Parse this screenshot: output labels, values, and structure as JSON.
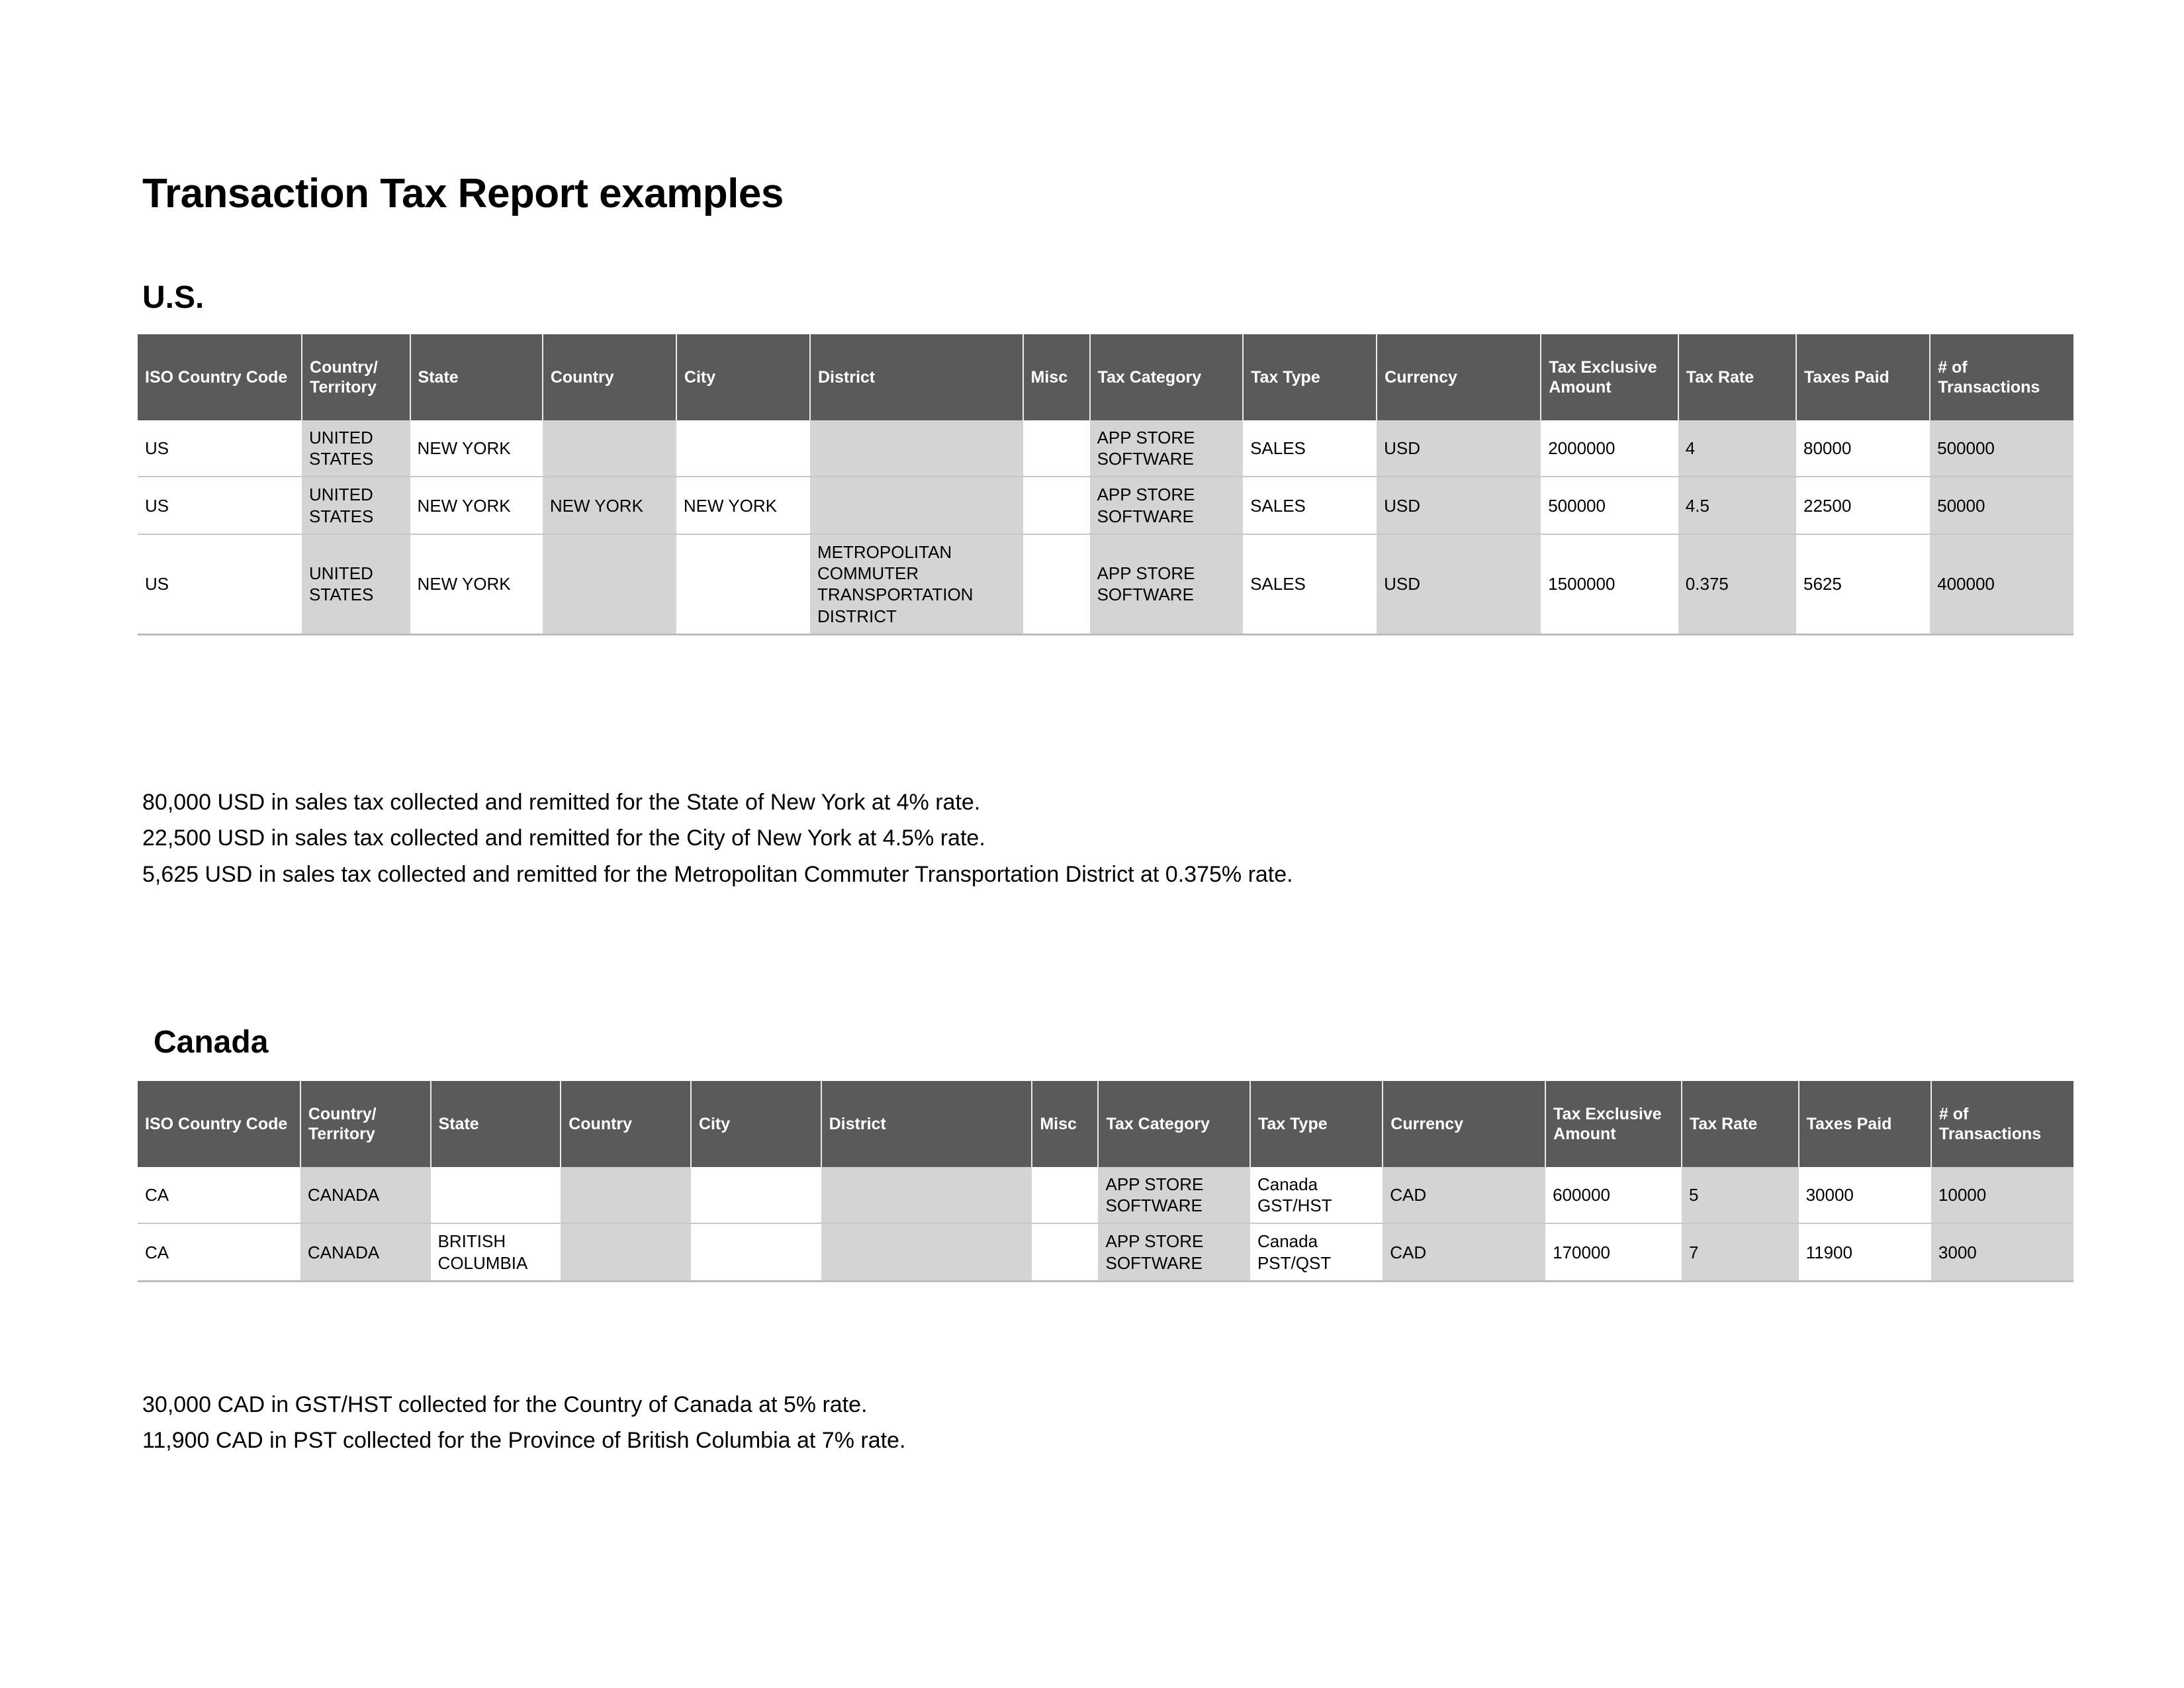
{
  "document": {
    "title": "Transaction Tax Report examples"
  },
  "columns": [
    "ISO Country Code",
    "Country/ Territory",
    "State",
    "Country",
    "City",
    "District",
    "Misc",
    "Tax Category",
    "Tax Type",
    "Currency",
    "Tax Exclusive Amount",
    "Tax Rate",
    "Taxes Paid",
    "# of Transactions"
  ],
  "colors": {
    "header_bg": "#5a5a5a",
    "header_text": "#ffffff",
    "shaded_cell_bg": "#d4d4d4",
    "plain_cell_bg": "#ffffff",
    "row_divider": "#c8c8c8"
  },
  "us": {
    "heading": "U.S.",
    "rows": [
      {
        "iso_country_code": "US",
        "country_territory": "UNITED STATES",
        "state": "NEW YORK",
        "country": "",
        "city": "",
        "district": "",
        "misc": "",
        "tax_category": "APP STORE SOFTWARE",
        "tax_type": "SALES",
        "currency": "USD",
        "tax_exclusive_amount": "2000000",
        "tax_rate": "4",
        "taxes_paid": "80000",
        "num_transactions": "500000"
      },
      {
        "iso_country_code": "US",
        "country_territory": "UNITED STATES",
        "state": "NEW YORK",
        "country": "NEW YORK",
        "city": "NEW YORK",
        "district": "",
        "misc": "",
        "tax_category": "APP STORE SOFTWARE",
        "tax_type": "SALES",
        "currency": "USD",
        "tax_exclusive_amount": "500000",
        "tax_rate": "4.5",
        "taxes_paid": "22500",
        "num_transactions": "50000"
      },
      {
        "iso_country_code": "US",
        "country_territory": "UNITED STATES",
        "state": "NEW YORK",
        "country": "",
        "city": "",
        "district": "METROPOLITAN COMMUTER TRANSPORTATION DISTRICT",
        "misc": "",
        "tax_category": "APP STORE SOFTWARE",
        "tax_type": "SALES",
        "currency": "USD",
        "tax_exclusive_amount": "1500000",
        "tax_rate": "0.375",
        "taxes_paid": "5625",
        "num_transactions": "400000"
      }
    ],
    "notes": [
      "80,000 USD in sales tax collected and remitted for the State of New York at 4% rate.",
      "22,500 USD in sales tax collected and remitted for the City of New York at 4.5% rate.",
      "5,625 USD in sales tax collected and remitted for the Metropolitan Commuter Transportation District at 0.375% rate."
    ]
  },
  "canada": {
    "heading": "Canada",
    "rows": [
      {
        "iso_country_code": "CA",
        "country_territory": "CANADA",
        "state": "",
        "country": "",
        "city": "",
        "district": "",
        "misc": "",
        "tax_category": "APP STORE SOFTWARE",
        "tax_type": "Canada GST/HST",
        "currency": "CAD",
        "tax_exclusive_amount": "600000",
        "tax_rate": "5",
        "taxes_paid": "30000",
        "num_transactions": "10000"
      },
      {
        "iso_country_code": "CA",
        "country_territory": "CANADA",
        "state": "BRITISH COLUMBIA",
        "country": "",
        "city": "",
        "district": "",
        "misc": "",
        "tax_category": "APP STORE SOFTWARE",
        "tax_type": "Canada PST/QST",
        "currency": "CAD",
        "tax_exclusive_amount": "170000",
        "tax_rate": "7",
        "taxes_paid": "11900",
        "num_transactions": "3000"
      }
    ],
    "notes": [
      "30,000 CAD in GST/HST collected for the Country of Canada at 5% rate.",
      "11,900 CAD in PST collected for the Province of British Columbia at 7% rate."
    ]
  }
}
